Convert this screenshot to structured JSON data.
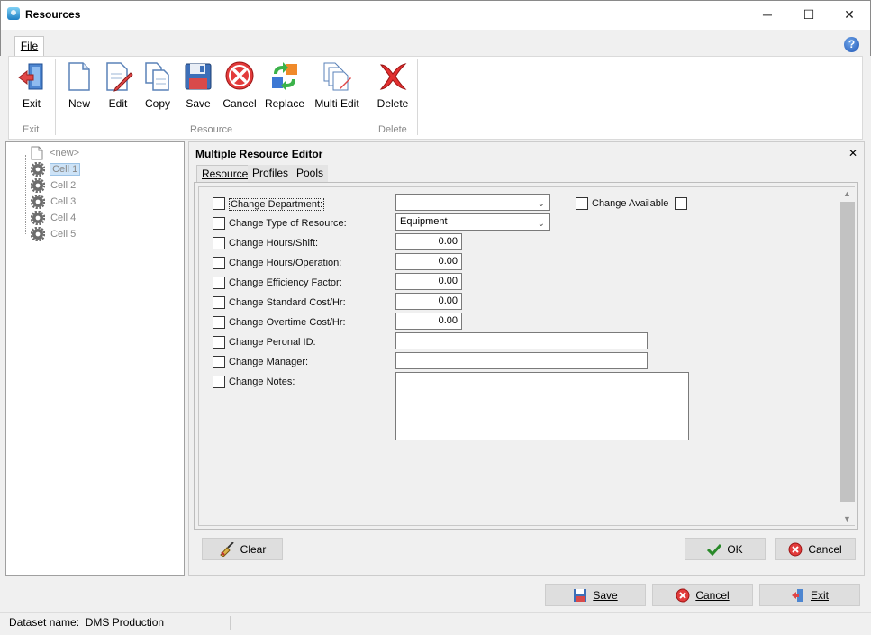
{
  "window": {
    "title": "Resources",
    "minimize_glyph": "─",
    "maximize_glyph": "☐",
    "close_glyph": "✕"
  },
  "ribbon": {
    "tab_file": "File",
    "help_glyph": "?",
    "buttons": {
      "exit": "Exit",
      "new": "New",
      "edit": "Edit",
      "copy": "Copy",
      "save": "Save",
      "cancel": "Cancel",
      "replace": "Replace",
      "multi_edit": "Multi Edit",
      "delete": "Delete"
    },
    "groups": {
      "exit": "Exit",
      "resource": "Resource",
      "delete": "Delete"
    }
  },
  "tree": {
    "items": [
      {
        "label": "<new>",
        "icon": "new-document-icon"
      },
      {
        "label": "Cell 1",
        "icon": "gear-icon",
        "selected": true
      },
      {
        "label": "Cell 2",
        "icon": "gear-icon"
      },
      {
        "label": "Cell 3",
        "icon": "gear-icon"
      },
      {
        "label": "Cell 4",
        "icon": "gear-icon"
      },
      {
        "label": "Cell 5",
        "icon": "gear-icon"
      }
    ]
  },
  "editor": {
    "title": "Multiple Resource Editor",
    "close_glyph": "✕",
    "tabs": [
      "Resource",
      "Profiles",
      "Pools"
    ],
    "fields": {
      "department": {
        "label": "Change Department:",
        "value": ""
      },
      "type": {
        "label": "Change Type of Resource:",
        "value": "Equipment"
      },
      "hours_shift": {
        "label": "Change Hours/Shift:",
        "value": "0.00"
      },
      "hours_operation": {
        "label": "Change Hours/Operation:",
        "value": "0.00"
      },
      "efficiency": {
        "label": "Change Efficiency Factor:",
        "value": "0.00"
      },
      "std_cost": {
        "label": "Change Standard Cost/Hr:",
        "value": "0.00"
      },
      "ot_cost": {
        "label": "Change Overtime Cost/Hr:",
        "value": "0.00"
      },
      "personal_id": {
        "label": "Change Peronal ID:",
        "value": ""
      },
      "manager": {
        "label": "Change Manager:",
        "value": ""
      },
      "notes": {
        "label": "Change Notes:",
        "value": ""
      }
    },
    "available_label": "Change Available",
    "clear_label": "Clear",
    "ok_label": "OK",
    "cancel_label": "Cancel"
  },
  "footer": {
    "save_label": "Save",
    "cancel_label": "Cancel",
    "exit_label": "Exit"
  },
  "status": {
    "dataset": "Dataset name:  DMS Production"
  }
}
